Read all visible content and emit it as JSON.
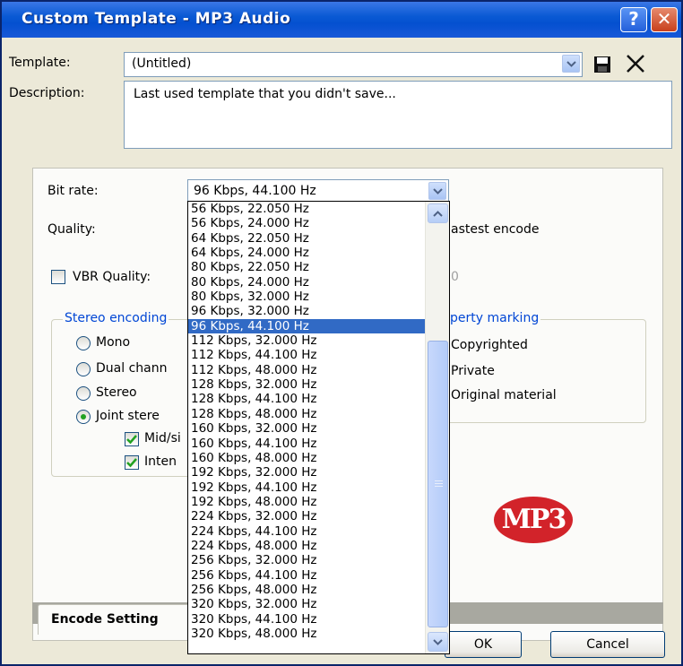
{
  "window": {
    "title": "Custom Template - MP3 Audio",
    "help_label": "?",
    "close_label": "✕"
  },
  "template": {
    "label": "Template:",
    "value": "(Untitled)"
  },
  "description": {
    "label": "Description:",
    "value": "Last used template that you didn't save..."
  },
  "settings": {
    "bit_rate_label": "Bit rate:",
    "bit_rate_value": "96 Kbps, 44.100 Hz",
    "quality_label": "Quality:",
    "quality_suffix": "astest encode",
    "vbr_label": "VBR Quality:",
    "vbr_value_partial": "0",
    "stereo_group_title": "Stereo encoding",
    "mono_label": "Mono",
    "dual_label": "Dual chann",
    "stereo_label": "Stereo",
    "joint_label": "Joint stere",
    "midside_label": "Mid/si",
    "intensity_label": "Inten",
    "property_group_title": "perty marking",
    "copyrighted_label": "Copyrighted",
    "private_label": "Private",
    "original_label": "Original material",
    "logo_text": "MP3"
  },
  "tabs": {
    "encode_label": "Encode Setting"
  },
  "buttons": {
    "ok_label": "OK",
    "cancel_label": "Cancel"
  },
  "bitrate_options": [
    "56 Kbps, 22.050 Hz",
    "56 Kbps, 24.000 Hz",
    "64 Kbps, 22.050 Hz",
    "64 Kbps, 24.000 Hz",
    "80 Kbps, 22.050 Hz",
    "80 Kbps, 24.000 Hz",
    "80 Kbps, 32.000 Hz",
    "96 Kbps, 32.000 Hz",
    "96 Kbps, 44.100 Hz",
    "112 Kbps, 32.000 Hz",
    "112 Kbps, 44.100 Hz",
    "112 Kbps, 48.000 Hz",
    "128 Kbps, 32.000 Hz",
    "128 Kbps, 44.100 Hz",
    "128 Kbps, 48.000 Hz",
    "160 Kbps, 32.000 Hz",
    "160 Kbps, 44.100 Hz",
    "160 Kbps, 48.000 Hz",
    "192 Kbps, 32.000 Hz",
    "192 Kbps, 44.100 Hz",
    "192 Kbps, 48.000 Hz",
    "224 Kbps, 32.000 Hz",
    "224 Kbps, 44.100 Hz",
    "224 Kbps, 48.000 Hz",
    "256 Kbps, 32.000 Hz",
    "256 Kbps, 44.100 Hz",
    "256 Kbps, 48.000 Hz",
    "320 Kbps, 32.000 Hz",
    "320 Kbps, 44.100 Hz",
    "320 Kbps, 48.000 Hz"
  ],
  "selected_option_index": 8,
  "colors": {
    "accent": "#316ac5",
    "title_bar": "#0450d0",
    "group_title": "#0046d5",
    "check_green": "#21a121",
    "logo_red": "#d2232a"
  }
}
